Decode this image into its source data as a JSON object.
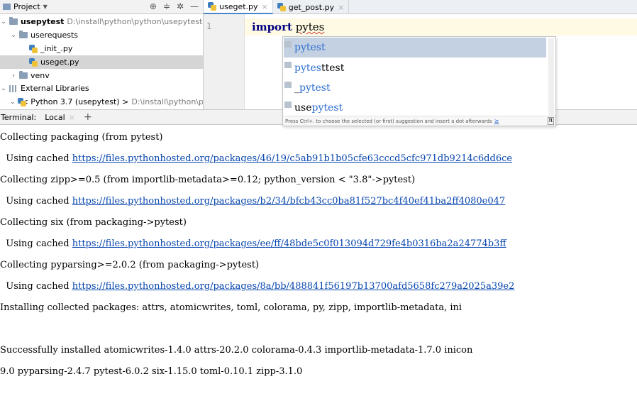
{
  "project_panel": {
    "title": "Project",
    "dropdown_icon": "caret-down-icon",
    "tools": [
      "target-icon",
      "collapse-icon",
      "gear-icon",
      "minimize-icon"
    ],
    "tree": [
      {
        "label": "usepytest",
        "path": "D:\\install\\python\\python\\usepytest",
        "type": "folder"
      },
      {
        "label": "userequests",
        "type": "folder"
      },
      {
        "label": "_init_.py",
        "type": "python-file"
      },
      {
        "label": "useget.py",
        "type": "python-file",
        "selected": true
      },
      {
        "label": "venv",
        "type": "folder"
      },
      {
        "label": "External Libraries",
        "type": "library"
      },
      {
        "label": "< Python 3.7 (usepytest) >",
        "path": "D:\\install\\python\\p",
        "type": "python-sdk"
      }
    ]
  },
  "editor_tabs": [
    {
      "label": "useget.py",
      "active": true
    },
    {
      "label": "get_post.py",
      "active": false
    }
  ],
  "editor": {
    "line_number": "1",
    "keyword": "import",
    "typed": "pytes"
  },
  "completion": {
    "items": [
      {
        "match": "pytest",
        "rest": "",
        "prefix": ""
      },
      {
        "match": "pytes",
        "rest": "ttest",
        "prefix": ""
      },
      {
        "prefix": "_",
        "match": "pytest",
        "rest": ""
      },
      {
        "prefix": "use",
        "match": "pytest",
        "rest": ""
      }
    ],
    "footer": "Press Ctrl+. to choose the selected (or first) suggestion and insert a dot afterwards",
    "footer_link": "≥",
    "footer_pi": "π"
  },
  "terminal": {
    "title": "Terminal:",
    "tab": "Local",
    "add": "+",
    "lines": [
      {
        "text": "Collecting packaging (from pytest)"
      },
      {
        "text": "  Using cached ",
        "link": "https://files.pythonhosted.org/packages/46/19/c5ab91b1b05cfe63cccd5cfc971db9214c6dd6ce"
      },
      {
        "text": "Collecting zipp>=0.5 (from importlib-metadata>=0.12; python_version < \"3.8\"->pytest)"
      },
      {
        "text": "  Using cached ",
        "link": "https://files.pythonhosted.org/packages/b2/34/bfcb43cc0ba81f527bc4f40ef41ba2ff4080e047"
      },
      {
        "text": "Collecting six (from packaging->pytest)"
      },
      {
        "text": "  Using cached ",
        "link": "https://files.pythonhosted.org/packages/ee/ff/48bde5c0f013094d729fe4b0316ba2a24774b3ff"
      },
      {
        "text": "Collecting pyparsing>=2.0.2 (from packaging->pytest)"
      },
      {
        "text": "  Using cached ",
        "link": "https://files.pythonhosted.org/packages/8a/bb/488841f56197b13700afd5658fc279a2025a39e2"
      },
      {
        "text": "Installing collected packages: attrs, atomicwrites, toml, colorama, py, zipp, importlib-metadata, ini"
      },
      {
        "text": ""
      },
      {
        "text": "Successfully installed atomicwrites-1.4.0 attrs-20.2.0 colorama-0.4.3 importlib-metadata-1.7.0 inicon"
      },
      {
        "text": "9.0 pyparsing-2.4.7 pytest-6.0.2 six-1.15.0 toml-0.10.1 zipp-3.1.0"
      }
    ]
  },
  "colors": {
    "accent": "#4a88c7",
    "selection": "#c4d1e2",
    "link": "#0645ad",
    "current_line": "#fffae3"
  }
}
